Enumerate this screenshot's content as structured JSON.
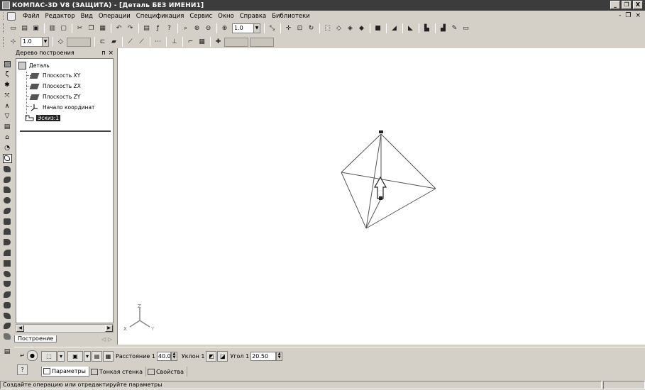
{
  "window": {
    "title": "КОМПАС-3D V8 (ЗАЩИТА) - [Деталь БЕЗ ИМЕНИ1]",
    "controls": [
      "_",
      "❐",
      "X"
    ]
  },
  "menu": {
    "items": [
      "Файл",
      "Редактор",
      "Вид",
      "Операции",
      "Спецификация",
      "Сервис",
      "Окно",
      "Справка",
      "Библиотеки"
    ],
    "right_controls": [
      "-",
      "❐",
      "×"
    ]
  },
  "toolbar": {
    "zoom_value": "1.0",
    "step_value": "1.0"
  },
  "tree": {
    "header": "Дерево построения",
    "header_buttons": [
      "ᴨ",
      "×"
    ],
    "root": "Деталь",
    "items": [
      "Плоскость XY",
      "Плоскость ZX",
      "Плоскость ZY",
      "Начало координат",
      "Эскиз:1"
    ],
    "tab": "Построение",
    "tab_nav": "◁ ▷"
  },
  "axes": {
    "x": "X",
    "y": "Y",
    "z": "Z"
  },
  "properties": {
    "distance_label": "Расстояние 1",
    "distance_value": "40.0",
    "slope_label": "Уклон 1",
    "angle_label": "Угол 1",
    "angle_value": "20.50",
    "tabs": [
      "Параметры",
      "Тонкая стенка",
      "Свойства"
    ]
  },
  "status": {
    "text": "Создайте операцию или отредактируйте параметры"
  }
}
